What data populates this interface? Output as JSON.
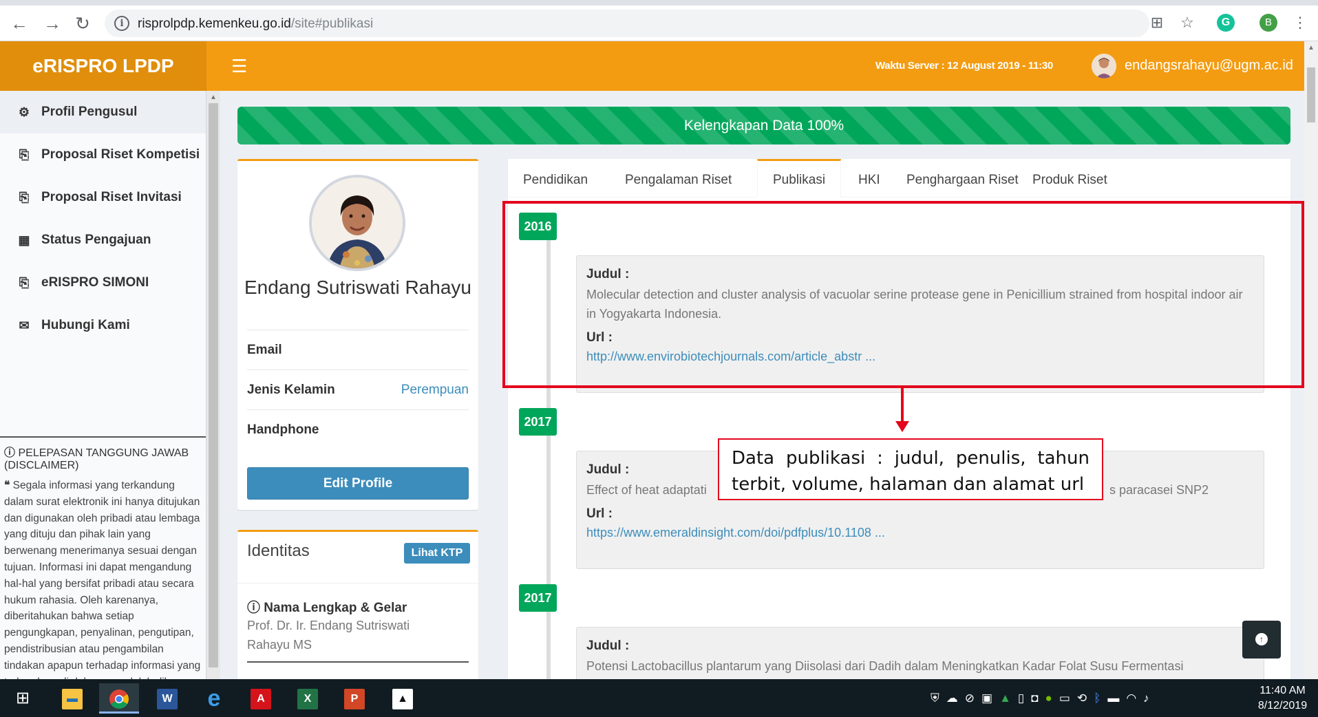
{
  "browser": {
    "url_host": "risprolpdp.kemenkeu.go.id",
    "url_path": "/site#publikasi"
  },
  "header": {
    "brand": "eRISPRO LPDP",
    "server_time": "Waktu Server : 12 August 2019 - 11:30",
    "user_email": "endangsrahayu@ugm.ac.id"
  },
  "sidebar": {
    "items": [
      {
        "label": "Profil Pengusul",
        "icon": "dashboard-icon",
        "glyph": "⚙"
      },
      {
        "label": "Proposal Riset Kompetisi",
        "icon": "copy-icon",
        "glyph": "⎘"
      },
      {
        "label": "Proposal Riset Invitasi",
        "icon": "copy-icon",
        "glyph": "⎘"
      },
      {
        "label": "Status Pengajuan",
        "icon": "grid-icon",
        "glyph": "▦"
      },
      {
        "label": "eRISPRO SIMONI",
        "icon": "copy-icon",
        "glyph": "⎘"
      },
      {
        "label": "Hubungi Kami",
        "icon": "envelope-icon",
        "glyph": "✉"
      }
    ],
    "disclaimer_title": "PELEPASAN TANGGUNG JAWAB (DISCLAIMER)",
    "disclaimer_body": "Segala informasi yang terkandung dalam surat elektronik ini hanya ditujukan dan digunakan oleh pribadi atau lembaga yang dituju dan pihak lain yang berwenang menerimanya sesuai dengan tujuan. Informasi ini dapat mengandung hal-hal yang bersifat pribadi atau secara hukum rahasia. Oleh karenanya, diberitahukan bahwa setiap pengungkapan, penyalinan, pengutipan, pendistribusian atau pengambilan tindakan apapun terhadap informasi yang terkandung di dalamnya adalah dilarang keras dan dapat merupakan tindakan melanggar hukum."
  },
  "progress": {
    "label": "Kelengkapan Data 100%",
    "value": 100
  },
  "profile": {
    "name": "Endang Sutriswati Rahayu",
    "email_label": "Email",
    "gender_label": "Jenis Kelamin",
    "gender_value": "Perempuan",
    "phone_label": "Handphone",
    "edit_button": "Edit Profile"
  },
  "identity": {
    "title": "Identitas",
    "ktp_button": "Lihat KTP",
    "name_label": "Nama Lengkap & Gelar",
    "name_value": "Prof. Dr. Ir. Endang Sutriswati Rahayu MS"
  },
  "tabs": [
    {
      "label": "Pendidikan"
    },
    {
      "label": "Pengalaman Riset"
    },
    {
      "label": "Publikasi"
    },
    {
      "label": "HKI"
    },
    {
      "label": "Penghargaan Riset"
    },
    {
      "label": "Produk Riset"
    }
  ],
  "publications": [
    {
      "year": "2016",
      "judul_label": "Judul :",
      "title": "Molecular detection and cluster analysis of vacuolar serine protease gene in Penicillium strained from hospital indoor air in Yogyakarta Indonesia.",
      "url_label": "Url :",
      "url": "http://www.envirobiotechjournals.com/article_abstr ..."
    },
    {
      "year": "2017",
      "judul_label": "Judul :",
      "title_left": "Effect of heat adaptati",
      "title_right": "s paracasei SNP2",
      "url_label": "Url :",
      "url": "https://www.emeraldinsight.com/doi/pdfplus/10.1108 ..."
    },
    {
      "year": "2017",
      "judul_label": "Judul :",
      "title": "Potensi Lactobacillus plantarum yang Diisolasi dari Dadih dalam Meningkatkan Kadar Folat Susu Fermentasi"
    }
  ],
  "callout": {
    "text": "Data publikasi : judul, penulis, tahun terbit, volume, halaman dan alamat url"
  },
  "taskbar": {
    "time": "11:40 AM",
    "date": "8/12/2019"
  },
  "colors": {
    "header": "#f39c12",
    "brand": "#e08e0b",
    "success": "#00a65a",
    "primary": "#3c8dbc",
    "annotation": "#e3061d"
  }
}
